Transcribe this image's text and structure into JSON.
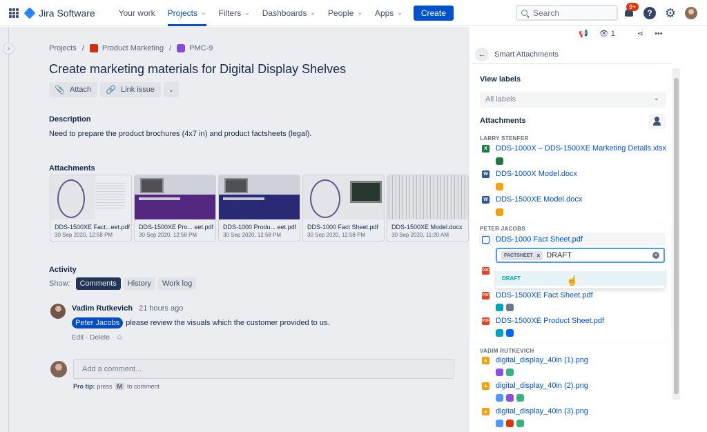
{
  "nav": {
    "app_name": "Jira Software",
    "items": [
      {
        "label": "Your work",
        "chevron": false,
        "active": false
      },
      {
        "label": "Projects",
        "chevron": true,
        "active": true
      },
      {
        "label": "Filters",
        "chevron": true,
        "active": false
      },
      {
        "label": "Dashboards",
        "chevron": true,
        "active": false
      },
      {
        "label": "People",
        "chevron": true,
        "active": false
      },
      {
        "label": "Apps",
        "chevron": true,
        "active": false
      }
    ],
    "create_label": "Create",
    "search_placeholder": "Search",
    "notification_badge": "9+",
    "help_glyph": "?",
    "settings_glyph": "⚙"
  },
  "breadcrumb": {
    "projects": "Projects",
    "separator": "/",
    "project": "Product Marketing",
    "issue_key": "PMC-9"
  },
  "issue": {
    "title": "Create marketing materials for Digital Display Shelves",
    "attach_label": "Attach",
    "link_label": "Link issue",
    "more_glyph": "⌄",
    "description_label": "Description",
    "description_text": "Need to prepare the product brochures (4x7 in) and product factsheets (legal).",
    "attachments_label": "Attachments",
    "attachments": [
      {
        "name": "DDS-1500XE Fact...eet.pdf",
        "date": "30 Sep 2020, 12:58 PM",
        "kind": "img-doc"
      },
      {
        "name": "DDS-1500XE Pro... eet.pdf",
        "date": "30 Sep 2020, 12:58 PM",
        "kind": "img-po"
      },
      {
        "name": "DDS-1000 Produ... eet.pdf",
        "date": "30 Sep 2020, 12:58 PM",
        "kind": "img-po2"
      },
      {
        "name": "DDS-1000 Fact Sheet.pdf",
        "date": "30 Sep 2020, 12:58 PM",
        "kind": "img-fs"
      },
      {
        "name": "DDS-1500XE Model.docx",
        "date": "30 Sep 2020, 11:20 AM",
        "kind": "img-model"
      }
    ]
  },
  "activity": {
    "label": "Activity",
    "show_label": "Show:",
    "tabs": [
      {
        "label": "Comments",
        "active": true
      },
      {
        "label": "History",
        "active": false
      },
      {
        "label": "Work log",
        "active": false
      }
    ],
    "comment": {
      "author": "Vadim Rutkevich",
      "time": "21 hours ago",
      "mention": "Peter Jacobs",
      "text": "please review the visuals which the customer provided to us.",
      "actions": "Edit · Delete · ☺"
    },
    "add_comment_placeholder": "Add a comment...",
    "protip_bold": "Pro tip:",
    "protip_press": "press",
    "protip_key": "M",
    "protip_rest": "to comment"
  },
  "right_panel": {
    "watch_count": "1",
    "smart_attachments_title": "Smart Attachments",
    "view_labels": "View labels",
    "labels_placeholder": "All labels",
    "attachments_label": "Attachments",
    "groups": {
      "larry": "LARRY STENFER",
      "peter": "PETER JACOBS",
      "vadim": "VADIM RUTKEVICH"
    },
    "files": {
      "f1": "DDS-1000X – DDS-1500XE Marketing Details.xlsx",
      "f2": "DDS-1000X Model.docx",
      "f3": "DDS-1500XE Model.docx",
      "f4": "DDS-1000 Fact Sheet.pdf",
      "f6": "DDS-1500XE Fact Sheet.pdf",
      "f7": "DDS-1500XE Product Sheet.pdf",
      "f8": "digital_display_40in (1).png",
      "f9": "digital_display_40in (2).png",
      "f10": "digital_display_40in (3).png"
    },
    "label_editor": {
      "tag": "FACTSHEET",
      "tag_remove": "×",
      "typed": "DRAFT",
      "clear": "×",
      "option": "DRAFT"
    },
    "chip_colors": {
      "teal": "#00a3bf",
      "gray": "#6b778c",
      "orange": "#f0a30a",
      "blue": "#0065ff",
      "purple": "#904ee2",
      "green": "#36b37e",
      "red": "#de350b",
      "darkgreen": "#1d7a45"
    }
  }
}
